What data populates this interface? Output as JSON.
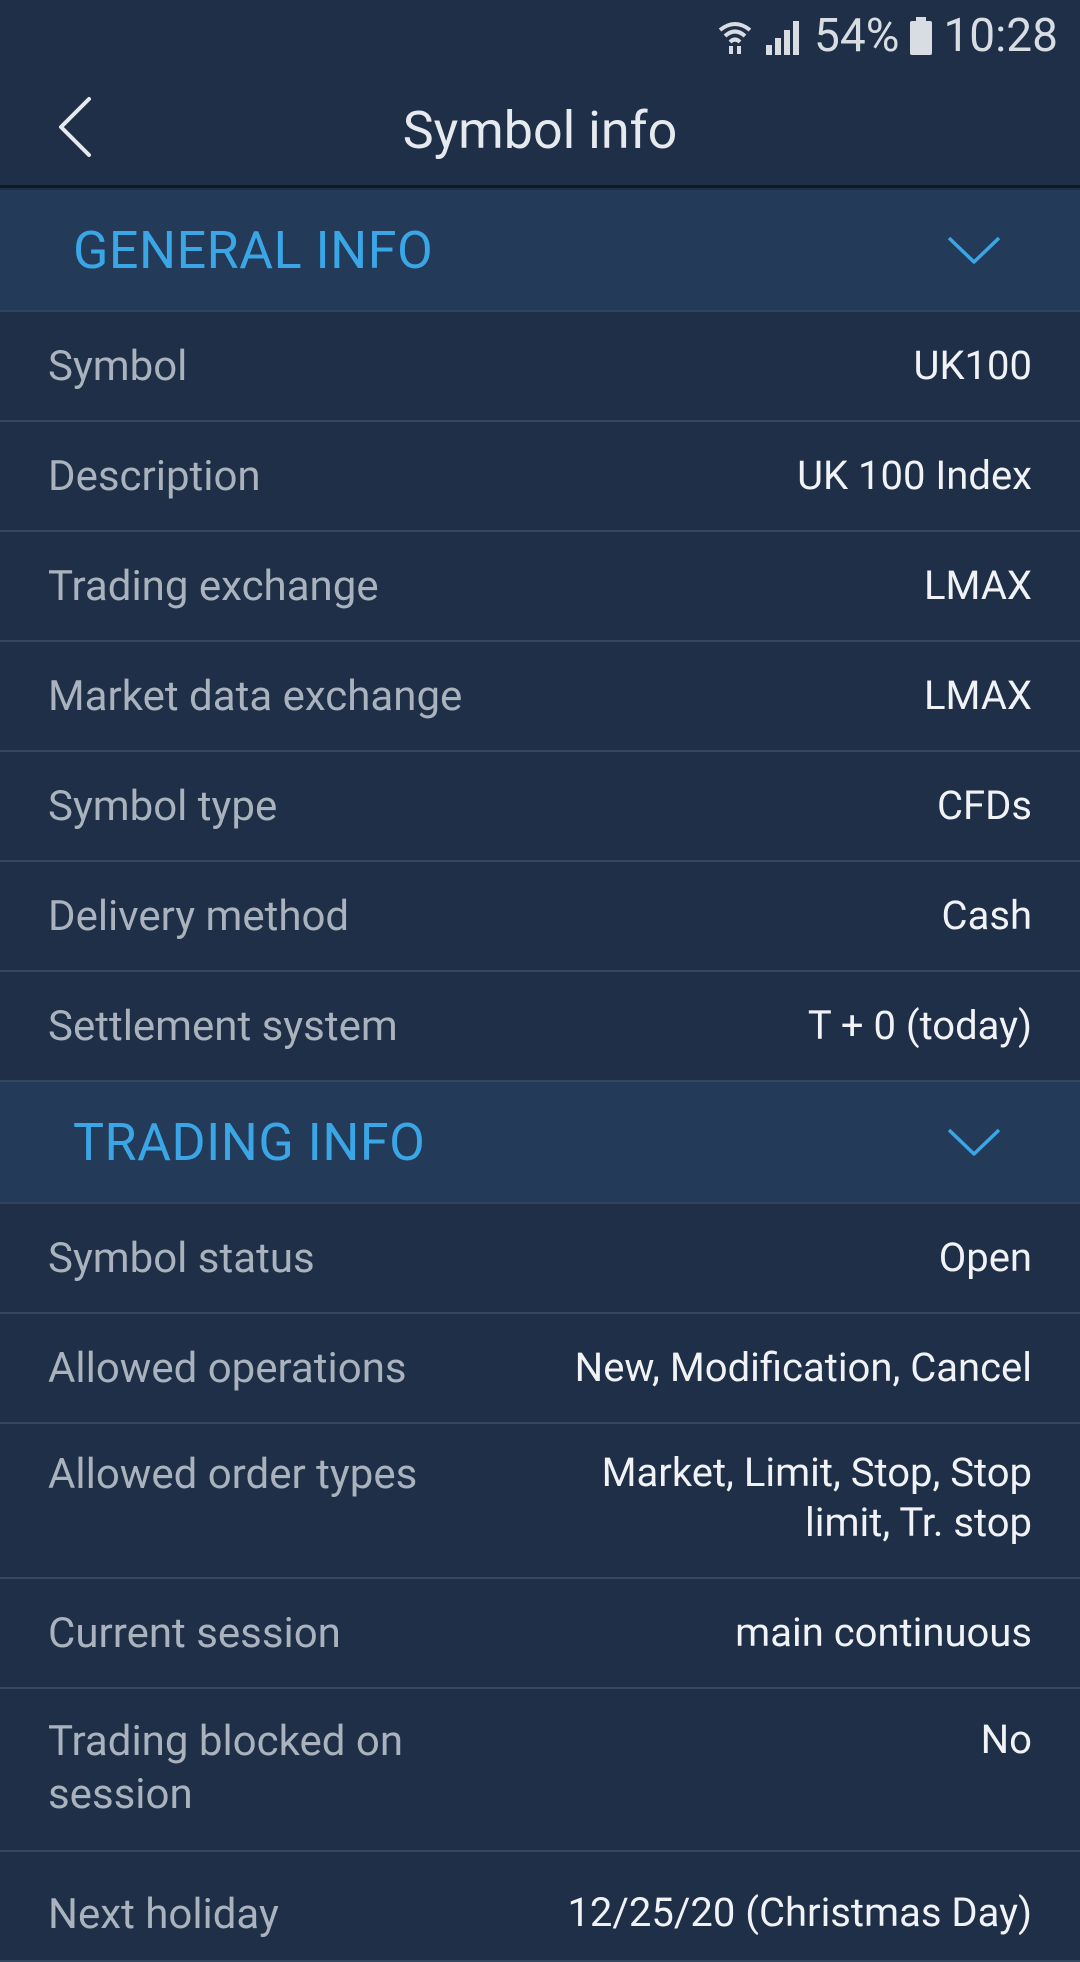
{
  "status_bar": {
    "battery": "54%",
    "time": "10:28"
  },
  "app_bar": {
    "title": "Symbol info",
    "back_icon": "chevron-left-icon"
  },
  "sections": {
    "general": {
      "title": "GENERAL INFO",
      "rows": [
        {
          "label": "Symbol",
          "value": "UK100"
        },
        {
          "label": "Description",
          "value": "UK 100 Index"
        },
        {
          "label": "Trading exchange",
          "value": "LMAX"
        },
        {
          "label": "Market data exchange",
          "value": "LMAX"
        },
        {
          "label": "Symbol type",
          "value": "CFDs"
        },
        {
          "label": "Delivery method",
          "value": "Cash"
        },
        {
          "label": "Settlement system",
          "value": "T + 0 (today)"
        }
      ]
    },
    "trading": {
      "title": "TRADING INFO",
      "rows": [
        {
          "label": "Symbol status",
          "value": "Open"
        },
        {
          "label": "Allowed operations",
          "value": "New, Modification, Cancel"
        },
        {
          "label": "Allowed order types",
          "value_line1": "Market, Limit, Stop, Stop",
          "value_line2": "limit, Tr. stop"
        },
        {
          "label": "Current session",
          "value": "main continuous"
        },
        {
          "label_line1": "Trading blocked on",
          "label_line2": "session",
          "value": "No"
        },
        {
          "label": "Next holiday",
          "value": "12/25/20 (Christmas Day)"
        }
      ]
    }
  },
  "colors": {
    "background": "#1e2f47",
    "section_header_bg": "#233a58",
    "accent": "#3aa6e6",
    "label": "#aab3bd",
    "value": "#f0f2f5"
  }
}
